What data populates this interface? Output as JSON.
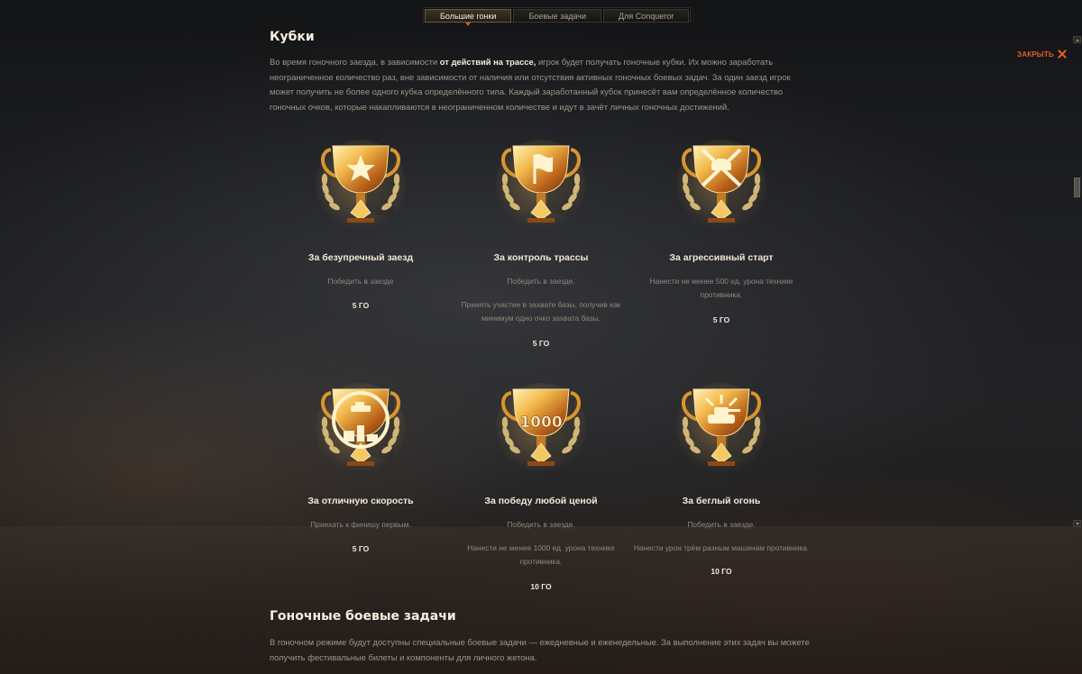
{
  "tabs": [
    {
      "label": "Большие гонки",
      "active": true
    },
    {
      "label": "Боевые задачи",
      "active": false
    },
    {
      "label": "Для Conqueror",
      "active": false
    }
  ],
  "close": {
    "label": "ЗАКРЫТЬ"
  },
  "cups_section": {
    "title": "Кубки",
    "intro_before": "Во время гоночного заезда, в зависимости ",
    "intro_bold": "от действий на трассе,",
    "intro_after": " игрок будет получать гоночные кубки. Их можно заработать неограниченное количество раз, вне зависимости от наличия или отсутствия активных гоночных боевых задач. За один заезд игрок может получить не более одного кубка определённого типа. Каждый заработанный кубок принесёт вам определённое количество гоночных очков, которые накапливаются в неограниченном количестве и идут в зачёт личных гоночных достижений."
  },
  "cups": [
    {
      "name": "За безупречный заезд",
      "desc1": "Победить в заезде",
      "desc2": "",
      "points": "5 ГО",
      "icon": "star-trophy-icon"
    },
    {
      "name": "За контроль трассы",
      "desc1": "Победить в заезде.",
      "desc2": "Принять участие в захвате базы, получив как минимум одно очко захвата базы.",
      "points": "5 ГО",
      "icon": "flag-trophy-icon"
    },
    {
      "name": "За агрессивный старт",
      "desc1": "Нанести не менее 500 ед. урона технике противника.",
      "desc2": "",
      "points": "5 ГО",
      "icon": "crossed-shells-trophy-icon"
    },
    {
      "name": "За отличную скорость",
      "desc1": "Приехать к финишу первым.",
      "desc2": "",
      "points": "5 ГО",
      "icon": "podium-trophy-icon"
    },
    {
      "name": "За победу любой ценой",
      "desc1": "Победить в заезде.",
      "desc2": "Нанести не менее 1000 ед. урона технике противника.",
      "points": "10 ГО",
      "icon": "number-1000-trophy-icon",
      "badge": "1000"
    },
    {
      "name": "За беглый огонь",
      "desc1": "Победить в заезде.",
      "desc2": "Нанести урон трём разным машинам противника.",
      "points": "10 ГО",
      "icon": "tank-trophy-icon"
    }
  ],
  "missions_section": {
    "title": "Гоночные боевые задачи",
    "text": "В гоночном режиме будут доступны специальные боевые задачи — ежедневные и еженедельные. За выполнение этих задач вы можете получить фестивальные билеты и компоненты для личного жетона."
  },
  "colors": {
    "accent": "#e25e2a",
    "gold": "#e0a53a",
    "title": "#f5efe0",
    "text": "#9c968a"
  }
}
